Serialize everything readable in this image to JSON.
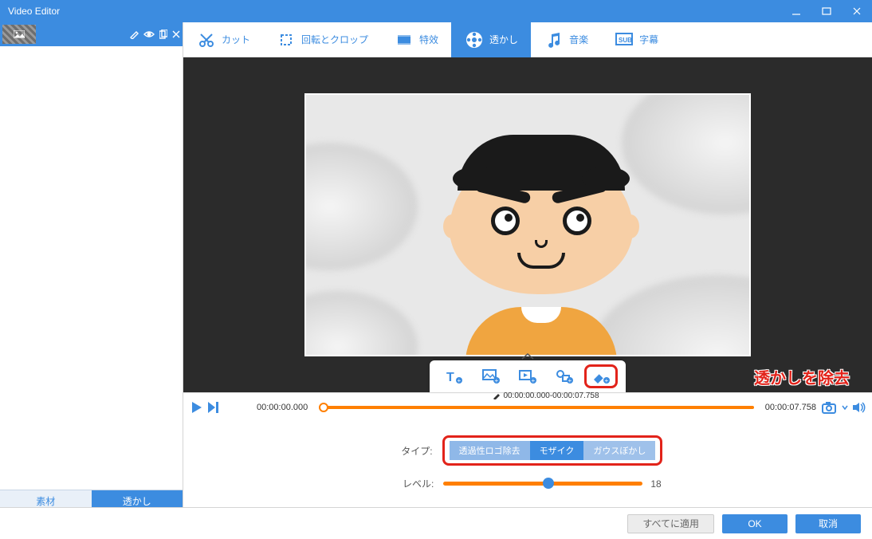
{
  "titlebar": {
    "title": "Video Editor"
  },
  "left": {
    "tabs": {
      "material": "素材",
      "watermark": "透かし"
    }
  },
  "tooltabs": {
    "cut": "カット",
    "rotate": "回転とクロップ",
    "effects": "特效",
    "watermark": "透かし",
    "music": "音楽",
    "subtitle": "字幕"
  },
  "timeline": {
    "start": "00:00:00.000",
    "range": "00:00:00.000-00:00:07.758",
    "end": "00:00:07.758"
  },
  "annotation": "透かしを除去",
  "controls": {
    "type_label": "タイプ:",
    "type_a": "透過性ロゴ除去",
    "type_b": "モザイク",
    "type_c": "ガウスぼかし",
    "level_label": "レベル:",
    "level_value": "18"
  },
  "footer": {
    "apply_all": "すべてに適用",
    "ok": "OK",
    "cancel": "取消"
  }
}
